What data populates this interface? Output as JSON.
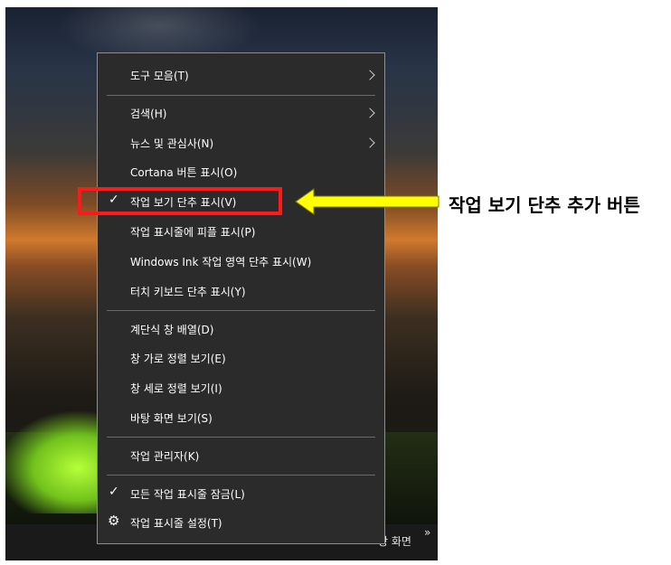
{
  "context_menu": {
    "items": [
      {
        "label": "도구 모음(T)"
      },
      {
        "label": "검색(H)"
      },
      {
        "label": "뉴스 및 관심사(N)"
      },
      {
        "label": "Cortana 버튼 표시(O)"
      },
      {
        "label": "작업 보기 단추 표시(V)"
      },
      {
        "label": "작업 표시줄에 피플 표시(P)"
      },
      {
        "label": "Windows Ink 작업 영역 단추 표시(W)"
      },
      {
        "label": "터치 키보드 단추 표시(Y)"
      },
      {
        "label": "계단식 창 배열(D)"
      },
      {
        "label": "창 가로 정렬 보기(E)"
      },
      {
        "label": "창 세로 정렬 보기(I)"
      },
      {
        "label": "바탕 화면 보기(S)"
      },
      {
        "label": "작업 관리자(K)"
      },
      {
        "label": "모든 작업 표시줄 잠금(L)"
      },
      {
        "label": "작업 표시줄 설정(T)"
      }
    ]
  },
  "taskbar": {
    "partial_text": "탕 화면",
    "chevron": "»"
  },
  "annotation": {
    "text": "작업 보기 단추 추가 버튼",
    "highlight_color": "#ff1a1a",
    "arrow_color": "#ffff00"
  },
  "icons": {
    "check": "checkmark-icon",
    "submenu": "chevron-right-icon",
    "settings": "gear-icon"
  }
}
